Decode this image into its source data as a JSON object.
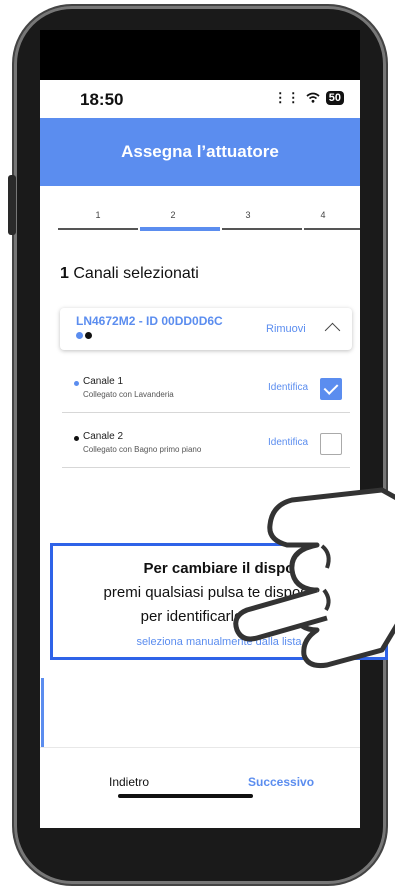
{
  "status_bar": {
    "time": "18:50",
    "battery": "50"
  },
  "header": {
    "title": "Assegna l’attuatore"
  },
  "stepper": {
    "steps": [
      "1",
      "2",
      "3",
      "4"
    ],
    "active_step": "2"
  },
  "selection": {
    "count": "1",
    "label": "Canali selezionati"
  },
  "device": {
    "name": "LN4672M2 - ID 00DD0D6C",
    "remove_label": "Rimuovi",
    "dot_colors": [
      "#5b8def",
      "#111111"
    ]
  },
  "channels": [
    {
      "name": "Canale 1",
      "subtitle": "Collegato con Lavanderia",
      "identify_label": "Identifica",
      "checked": true,
      "dot_color": "#5b8def"
    },
    {
      "name": "Canale 2",
      "subtitle": "Collegato con Bagno primo piano",
      "identify_label": "Identifica",
      "checked": false,
      "dot_color": "#111111"
    }
  ],
  "overlay": {
    "title": "Per cambiare il dispo",
    "line2": "premi qualsiasi pulsa te dispositivo",
    "line3": "per identificarlo, oppure",
    "link": "seleziona manualmente dalla lista"
  },
  "footer": {
    "back_label": "Indietro",
    "next_label": "Successivo"
  },
  "colors": {
    "accent": "#5b8def",
    "overlay_border": "#2f63e8"
  }
}
